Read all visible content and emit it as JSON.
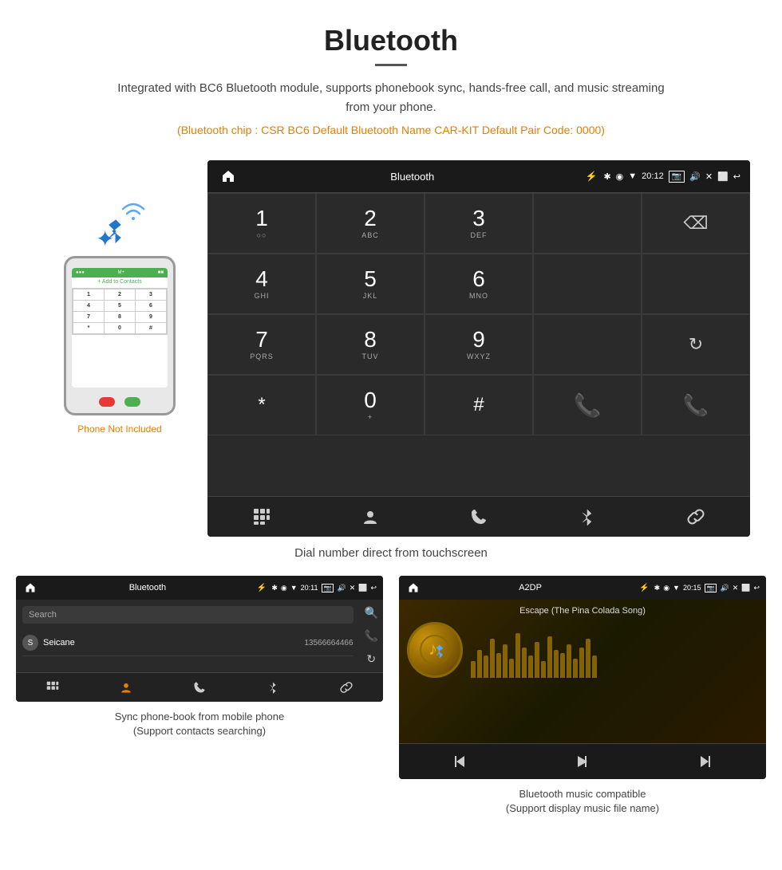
{
  "page": {
    "title": "Bluetooth",
    "underline": true,
    "description": "Integrated with BC6 Bluetooth module, supports phonebook sync, hands-free call, and music streaming from your phone.",
    "info_line": "(Bluetooth chip : CSR BC6    Default Bluetooth Name CAR-KIT    Default Pair Code: 0000)",
    "main_caption": "Dial number direct from touchscreen",
    "bottom_caption_left": "Sync phone-book from mobile phone\n(Support contacts searching)",
    "bottom_caption_right": "Bluetooth music compatible\n(Support display music file name)"
  },
  "car_screen": {
    "status_bar": {
      "title": "Bluetooth",
      "time": "20:12"
    },
    "dialpad": {
      "keys": [
        {
          "num": "1",
          "sub": "○○"
        },
        {
          "num": "2",
          "sub": "ABC"
        },
        {
          "num": "3",
          "sub": "DEF"
        },
        {
          "num": "",
          "sub": ""
        },
        {
          "num": "",
          "sub": "",
          "type": "backspace"
        },
        {
          "num": "4",
          "sub": "GHI"
        },
        {
          "num": "5",
          "sub": "JKL"
        },
        {
          "num": "6",
          "sub": "MNO"
        },
        {
          "num": "",
          "sub": ""
        },
        {
          "num": "",
          "sub": ""
        },
        {
          "num": "7",
          "sub": "PQRS"
        },
        {
          "num": "8",
          "sub": "TUV"
        },
        {
          "num": "9",
          "sub": "WXYZ"
        },
        {
          "num": "",
          "sub": ""
        },
        {
          "num": "",
          "sub": "",
          "type": "refresh"
        },
        {
          "num": "*",
          "sub": ""
        },
        {
          "num": "0",
          "sub": "+"
        },
        {
          "num": "#",
          "sub": ""
        },
        {
          "num": "",
          "sub": "",
          "type": "call-green"
        },
        {
          "num": "",
          "sub": "",
          "type": "call-red"
        }
      ],
      "bottom_nav": [
        "⊞",
        "👤",
        "📞",
        "✱",
        "🔗"
      ]
    }
  },
  "phonebook_screen": {
    "status_bar": {
      "title": "Bluetooth",
      "time": "20:11"
    },
    "search_placeholder": "Search",
    "contacts": [
      {
        "initial": "S",
        "name": "Seicane",
        "phone": "13566664466"
      }
    ],
    "bottom_nav": [
      "⊞",
      "👤",
      "📞",
      "✱",
      "🔗"
    ]
  },
  "music_screen": {
    "status_bar": {
      "title": "A2DP",
      "time": "20:15"
    },
    "song_title": "Escape (The Pina Colada Song)",
    "controls": [
      "prev",
      "play-pause",
      "next"
    ],
    "eq_bars": [
      30,
      50,
      40,
      60,
      45,
      55,
      35,
      65,
      50,
      40,
      60,
      30,
      55,
      45,
      50
    ]
  },
  "phone_mockup": {
    "not_included_text": "Phone Not Included",
    "contacts_button": "+ Add to Contacts",
    "keys": [
      "1",
      "2",
      "3",
      "4",
      "5",
      "6",
      "7",
      "8",
      "9",
      "*",
      "0",
      "#"
    ]
  }
}
